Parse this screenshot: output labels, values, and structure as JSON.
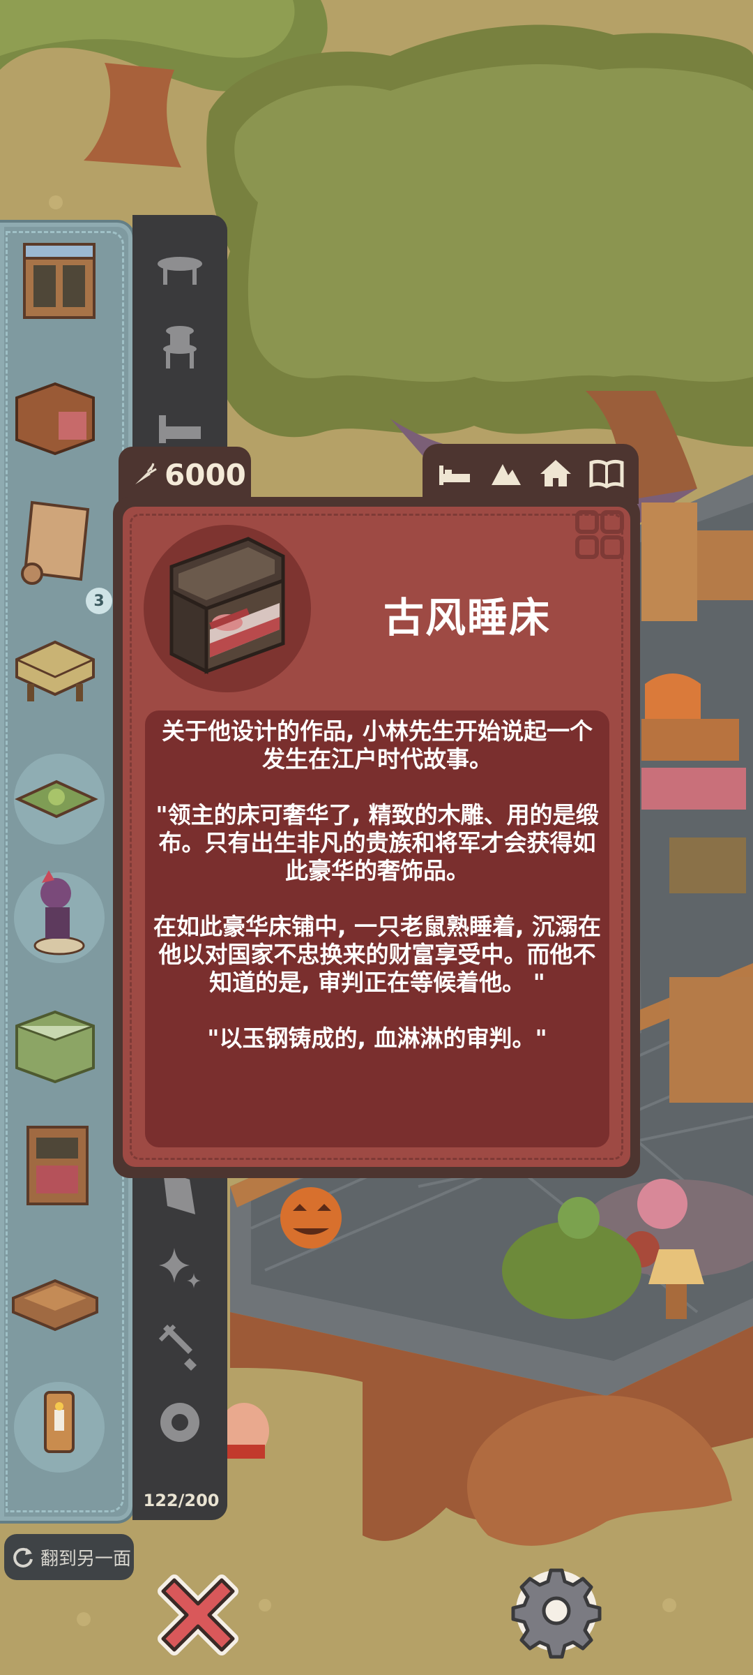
{
  "currency": {
    "icon": "carrot-icon",
    "amount": "6000"
  },
  "filter_tabs": [
    {
      "name": "bed-filter-icon"
    },
    {
      "name": "tent-filter-icon"
    },
    {
      "name": "house-filter-icon"
    },
    {
      "name": "book-filter-icon"
    }
  ],
  "item": {
    "name": "古风睡床",
    "description": [
      "关于他设计的作品, 小林先生开始说起一个发生在江户时代故事。",
      "\"领主的床可奢华了, 精致的木雕、用的是缎布。只有出生非凡的贵族和将军才会获得如此豪华的奢饰品。",
      "在如此豪华床铺中, 一只老鼠熟睡着, 沉溺在他以对国家不忠换来的财富享受中。而他不知道的是, 审判正在等候着他。 \"",
      "\"以玉钢铸成的, 血淋淋的审判。\""
    ]
  },
  "inventory": {
    "badge_count": "3",
    "count": "122/200"
  },
  "flip_button": {
    "label": "翻到另一面"
  },
  "colors": {
    "card": "#9e4a44",
    "card_dark": "#4d3530",
    "desc_bg": "#7a2f2e",
    "inventory": "#7f9aa0"
  }
}
